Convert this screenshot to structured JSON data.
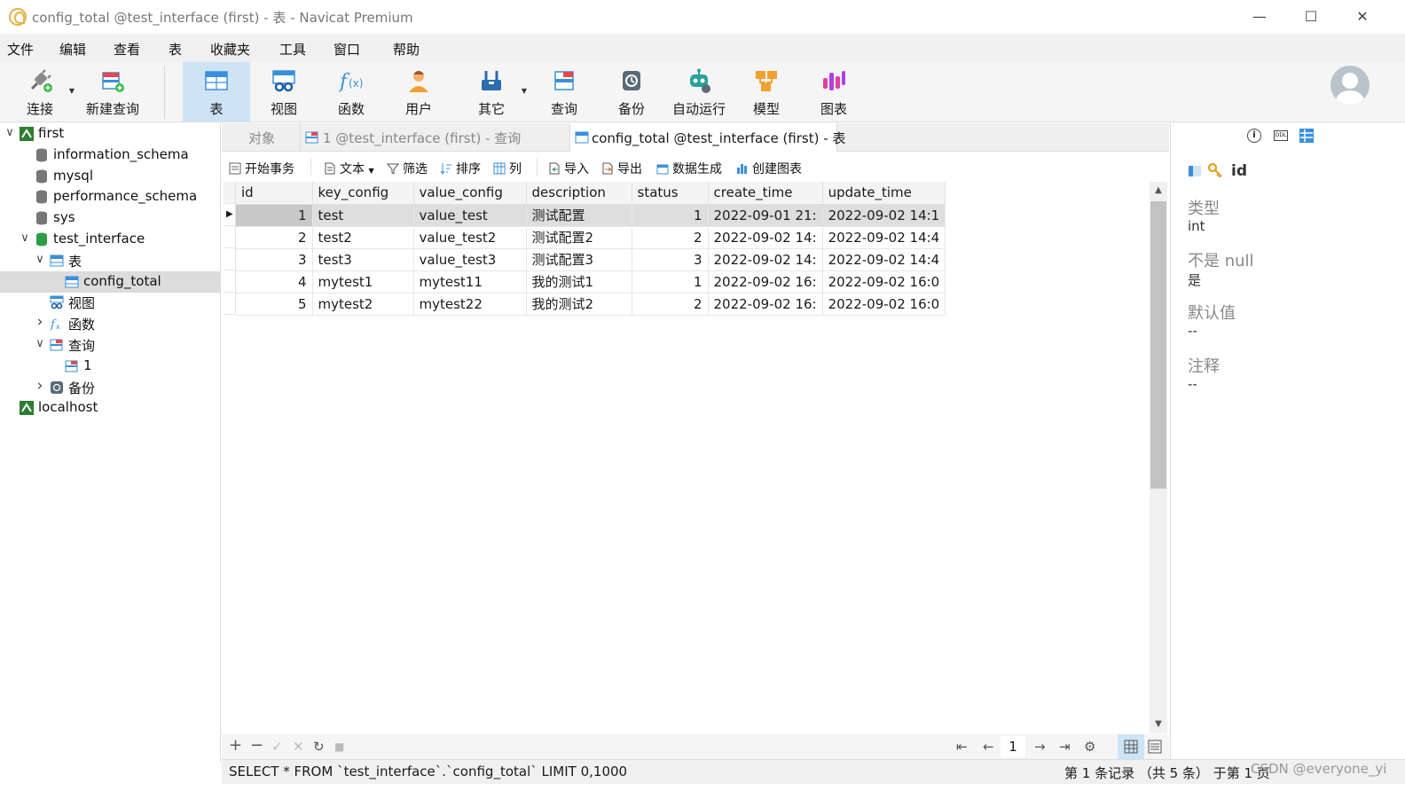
{
  "window": {
    "title": "config_total @test_interface (first) - 表 - Navicat Premium",
    "minimize": "—",
    "maximize": "☐",
    "close": "✕"
  },
  "menu": [
    "文件",
    "编辑",
    "查看",
    "表",
    "收藏夹",
    "工具",
    "窗口",
    "帮助"
  ],
  "toolbar": [
    {
      "label": "连接",
      "icon": "plug-icon",
      "has_caret": true
    },
    {
      "label": "新建查询",
      "icon": "new-query-icon",
      "has_caret": false
    },
    {
      "label": "表",
      "icon": "table-icon",
      "active": true
    },
    {
      "label": "视图",
      "icon": "view-icon"
    },
    {
      "label": "函数",
      "icon": "function-icon"
    },
    {
      "label": "用户",
      "icon": "user-icon"
    },
    {
      "label": "其它",
      "icon": "tools-icon",
      "has_caret": true
    },
    {
      "label": "查询",
      "icon": "query-icon"
    },
    {
      "label": "备份",
      "icon": "backup-icon"
    },
    {
      "label": "自动运行",
      "icon": "robot-icon"
    },
    {
      "label": "模型",
      "icon": "model-icon"
    },
    {
      "label": "图表",
      "icon": "chart-icon"
    }
  ],
  "tree": [
    {
      "label": "first",
      "level": 0,
      "arrow": "⌄",
      "icon": "connection-icon"
    },
    {
      "label": "information_schema",
      "level": 1,
      "icon": "database-icon"
    },
    {
      "label": "mysql",
      "level": 1,
      "icon": "database-icon"
    },
    {
      "label": "performance_schema",
      "level": 1,
      "icon": "database-icon"
    },
    {
      "label": "sys",
      "level": 1,
      "icon": "database-icon"
    },
    {
      "label": "test_interface",
      "level": 1,
      "arrow": "⌄",
      "icon": "database-open-icon"
    },
    {
      "label": "表",
      "level": 2,
      "arrow": "⌄",
      "icon": "table-icon"
    },
    {
      "label": "config_total",
      "level": 3,
      "icon": "table-icon",
      "selected": true
    },
    {
      "label": "视图",
      "level": 2,
      "icon": "view-icon"
    },
    {
      "label": "函数",
      "level": 2,
      "arrow": "›",
      "icon": "function-icon"
    },
    {
      "label": "查询",
      "level": 2,
      "arrow": "⌄",
      "icon": "query-icon"
    },
    {
      "label": "1",
      "level": 3,
      "icon": "query-icon"
    },
    {
      "label": "备份",
      "level": 2,
      "arrow": "›",
      "icon": "backup-icon"
    },
    {
      "label": "localhost",
      "level": 0,
      "icon": "connection-icon"
    }
  ],
  "tabs": [
    {
      "label": "对象"
    },
    {
      "label": "1 @test_interface (first) - 查询"
    },
    {
      "label": "config_total @test_interface (first) - 表",
      "active": true
    }
  ],
  "data_toolbar": [
    "开始事务",
    "文本",
    "筛选",
    "排序",
    "列",
    "导入",
    "导出",
    "数据生成",
    "创建图表"
  ],
  "grid": {
    "columns": [
      "id",
      "key_config",
      "value_config",
      "description",
      "status",
      "create_time",
      "update_time"
    ],
    "rows": [
      [
        "1",
        "test",
        "value_test",
        "测试配置",
        "1",
        "2022-09-01 21:",
        "2022-09-02 14:1"
      ],
      [
        "2",
        "test2",
        "value_test2",
        "测试配置2",
        "2",
        "2022-09-02 14:",
        "2022-09-02 14:4"
      ],
      [
        "3",
        "test3",
        "value_test3",
        "测试配置3",
        "3",
        "2022-09-02 14:",
        "2022-09-02 14:4"
      ],
      [
        "4",
        "mytest1",
        "mytest11",
        "我的测试1",
        "1",
        "2022-09-02 16:",
        "2022-09-02 16:0"
      ],
      [
        "5",
        "mytest2",
        "mytest22",
        "我的测试2",
        "2",
        "2022-09-02 16:",
        "2022-09-02 16:0"
      ]
    ],
    "selected_row": 0
  },
  "nav": {
    "page": "1",
    "first": "⇤",
    "prev": "←",
    "next": "→",
    "last": "⇥"
  },
  "status": {
    "sql": "SELECT * FROM `test_interface`.`config_total` LIMIT 0,1000",
    "record": "第 1 条记录 （共 5 条） 于第 1 页",
    "watermark": "CSDN @everyone_yi"
  },
  "inspector": {
    "field": "id",
    "type_label": "类型",
    "type_value": "int",
    "notnull_label": "不是 null",
    "notnull_value": "是",
    "default_label": "默认值",
    "default_value": "--",
    "comment_label": "注释",
    "comment_value": "--"
  },
  "colors": {
    "accent": "#3a8fdb",
    "active_tool": "#cde4f7"
  }
}
